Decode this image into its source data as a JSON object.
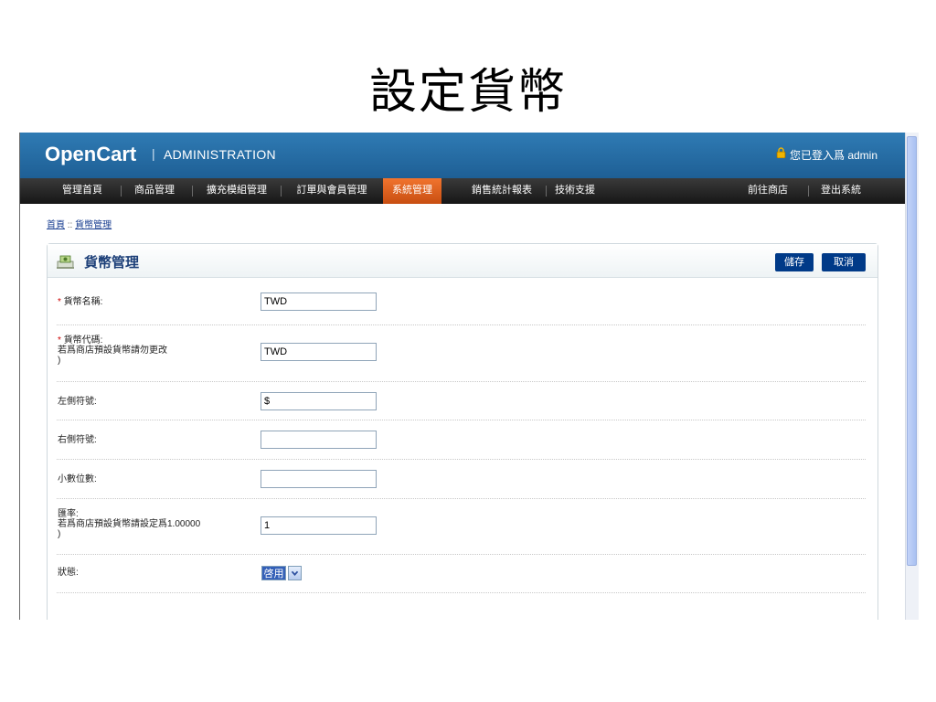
{
  "slide": {
    "title": "設定貨幣"
  },
  "header": {
    "logo": "OpenCart",
    "logo_sep": "|",
    "logo_sub": "ADMINISTRATION",
    "login_text": "您已登入爲 admin"
  },
  "menu": {
    "items": [
      {
        "label": "管理首頁"
      },
      {
        "label": "商品管理"
      },
      {
        "label": "擴充模組管理"
      },
      {
        "label": "訂單與會員管理"
      },
      {
        "label": "系統管理"
      },
      {
        "label": "銷售統計報表"
      },
      {
        "label": "技術支援"
      }
    ],
    "right": [
      {
        "label": "前往商店"
      },
      {
        "label": "登出系統"
      }
    ]
  },
  "breadcrumb": {
    "home": "首頁",
    "sep": " :: ",
    "current": "貨幣管理"
  },
  "panel": {
    "title": "貨幣管理",
    "save_label": "儲存",
    "cancel_label": "取消"
  },
  "form": {
    "title": {
      "required": "*",
      "label": "貨幣名稱:",
      "value": "TWD"
    },
    "code": {
      "required": "*",
      "label": "貨幣代碼:",
      "help": "若爲商店預設貨幣請勿更改",
      "help_close": ")",
      "value": "TWD"
    },
    "symbol_left": {
      "label": "左側符號:",
      "value": "$"
    },
    "symbol_right": {
      "label": "右側符號:",
      "value": ""
    },
    "decimal_place": {
      "label": "小數位數:",
      "value": ""
    },
    "rate": {
      "label": "匯率:",
      "help": "若爲商店預設貨幣請設定爲1.00000",
      "help_close": ")",
      "value": "1"
    },
    "status": {
      "label": "狀態:",
      "value": "啓用"
    }
  },
  "colors": {
    "header_blue": "#2473ad",
    "menu_dark": "#222222",
    "menu_active": "#e4621f",
    "button_blue": "#003a88",
    "title_blue": "#1c3f78"
  }
}
